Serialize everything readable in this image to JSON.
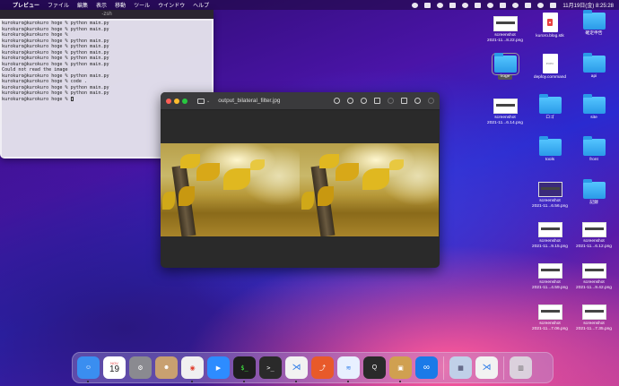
{
  "menubar": {
    "app_name": "プレビュー",
    "items": [
      "ファイル",
      "編集",
      "表示",
      "移動",
      "ツール",
      "ウインドウ",
      "ヘルプ"
    ],
    "clock": "11月19日(金)  8:25:28"
  },
  "terminal": {
    "title": "-zsh",
    "lines": [
      "kurokuro@kurokuro hoge % python main.py",
      "kurokuro@kurokuro hoge % python main.py",
      "kurokuro@kurokuro hoge %",
      "kurokuro@kurokuro hoge % python main.py",
      "kurokuro@kurokuro hoge % python main.py",
      "kurokuro@kurokuro hoge % python main.py",
      "kurokuro@kurokuro hoge % python main.py",
      "kurokuro@kurokuro hoge % python main.py",
      "Could not read the image",
      "kurokuro@kurokuro hoge % python main.py",
      "kurokuro@kurokuro hoge % code .",
      "kurokuro@kurokuro hoge % python main.py",
      "kurokuro@kurokuro hoge % python main.py",
      "kurokuro@kurokuro hoge % "
    ]
  },
  "preview": {
    "title": "output_bilateral_filter.jpg"
  },
  "desktop": {
    "icons": [
      {
        "type": "screenshot",
        "line1": "screenshot",
        "line2": "2021-11...8.22.png"
      },
      {
        "type": "file",
        "line1": "kuroro.blog.stk",
        "line2": "",
        "file_mark": "stk"
      },
      {
        "type": "folder",
        "line1": "確定申告",
        "line2": ""
      },
      {
        "type": "folder",
        "line1": "hoge",
        "line2": "",
        "selected": true
      },
      {
        "type": "file",
        "line1": "deploy.command",
        "line2": "",
        "file_mark": "exec"
      },
      {
        "type": "folder",
        "line1": "api",
        "line2": ""
      },
      {
        "type": "screenshot",
        "line1": "screenshot",
        "line2": "2021-11...6.14.png"
      },
      {
        "type": "folder",
        "line1": "ロゴ",
        "line2": ""
      },
      {
        "type": "folder",
        "line1": "site",
        "line2": ""
      },
      {
        "type": "folder",
        "line1": "tools",
        "line2": ""
      },
      {
        "type": "folder",
        "line1": "front",
        "line2": ""
      },
      {
        "type": "screenshot",
        "line1": "screenshot",
        "line2": "2021-11...6.56.png"
      },
      {
        "type": "folder",
        "line1": "記録",
        "line2": ""
      },
      {
        "type": "screenshot",
        "line1": "screenshot",
        "line2": "2021-11...9.15.png"
      },
      {
        "type": "screenshot",
        "line1": "screenshot",
        "line2": "2021-11...6.12.png"
      },
      {
        "type": "screenshot",
        "line1": "screenshot",
        "line2": "2021-11...4.59.png"
      },
      {
        "type": "screenshot",
        "line1": "screenshot",
        "line2": "2021-11...9.42.png"
      },
      {
        "type": "screenshot",
        "line1": "screenshot",
        "line2": "2021-11...7.06.png"
      },
      {
        "type": "screenshot",
        "line1": "screenshot",
        "line2": "2021-11...7.35.png"
      }
    ]
  },
  "dock": {
    "calendar_month": "NOV",
    "calendar_day": "19",
    "apps": [
      {
        "name": "finder",
        "color": "#3a8ef0",
        "glyph": "☺"
      },
      {
        "name": "calendar",
        "color": "#ffffff",
        "glyph": ""
      },
      {
        "name": "system-preferences",
        "color": "#8a8a90",
        "glyph": "⚙"
      },
      {
        "name": "contacts",
        "color": "#c8a070",
        "glyph": "☻"
      },
      {
        "name": "chrome",
        "color": "#e8e8e8",
        "glyph": "◉"
      },
      {
        "name": "zoom",
        "color": "#2d8cff",
        "glyph": "▶"
      },
      {
        "name": "terminal",
        "color": "#1e1e1e",
        "glyph": "$_"
      },
      {
        "name": "terminal-alt",
        "color": "#2a2a2a",
        "glyph": ">_"
      },
      {
        "name": "vscode",
        "color": "#f2f2f2",
        "glyph": "⋊"
      },
      {
        "name": "git-tool",
        "color": "#e85a2a",
        "glyph": "⤴"
      },
      {
        "name": "docker",
        "color": "#e8f0ff",
        "glyph": "🐳"
      },
      {
        "name": "quicktime",
        "color": "#2a2a2a",
        "glyph": "Q"
      },
      {
        "name": "preview",
        "color": "#d0a050",
        "glyph": "▣"
      },
      {
        "name": "infinity-app",
        "color": "#1a7ae8",
        "glyph": "∞"
      },
      {
        "name": "image-folder",
        "color": "#c0d0e8",
        "glyph": "▦"
      },
      {
        "name": "vscode-recent",
        "color": "#f2f2f2",
        "glyph": "⋊"
      },
      {
        "name": "trash",
        "color": "#d8d8d8",
        "glyph": "🗑"
      }
    ]
  }
}
